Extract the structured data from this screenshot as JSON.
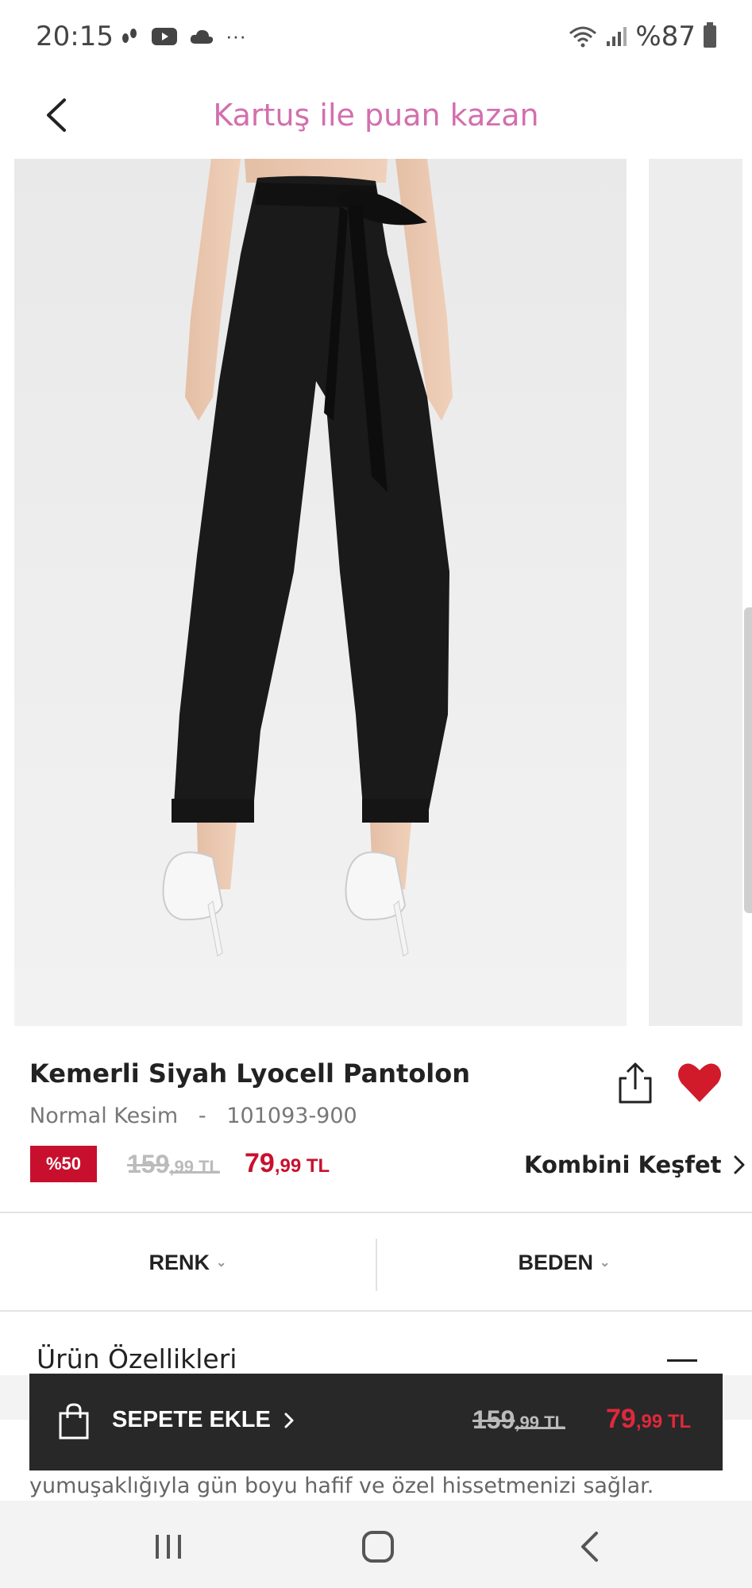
{
  "status_bar": {
    "time": "20:15",
    "more": "···",
    "battery": "%87"
  },
  "header": {
    "title": "Kartuş ile puan kazan"
  },
  "product": {
    "title": "Kemerli Siyah Lyocell Pantolon",
    "fit": "Normal Kesim",
    "separator": "-",
    "code": "101093-900",
    "discount_badge": "%50",
    "old_price_main": "159",
    "old_price_fraction": ",99 TL",
    "new_price_main": "79",
    "new_price_fraction": ",99 TL",
    "kombini_label": "Kombini Keşfet"
  },
  "selectors": {
    "color_label": "RENK",
    "size_label": "BEDEN"
  },
  "features": {
    "title": "Ürün Özellikleri",
    "description": "yumuşaklığıyla gün boyu hafif ve özel hissetmenizi sağlar."
  },
  "cart": {
    "label": "SEPETE EKLE",
    "old_price_main": "159",
    "old_price_fraction": ",99 TL",
    "new_price_main": "79",
    "new_price_fraction": ",99 TL"
  },
  "colors": {
    "accent_pink": "#d36fae",
    "sale_red": "#c8102e",
    "cart_bg": "#282828"
  },
  "icons": [
    "back-icon",
    "share-icon",
    "heart-icon",
    "chevron-right-icon",
    "chevron-down-icon",
    "minus-icon",
    "shopping-bag-icon",
    "recent-apps-icon",
    "home-icon",
    "nav-back-icon"
  ]
}
